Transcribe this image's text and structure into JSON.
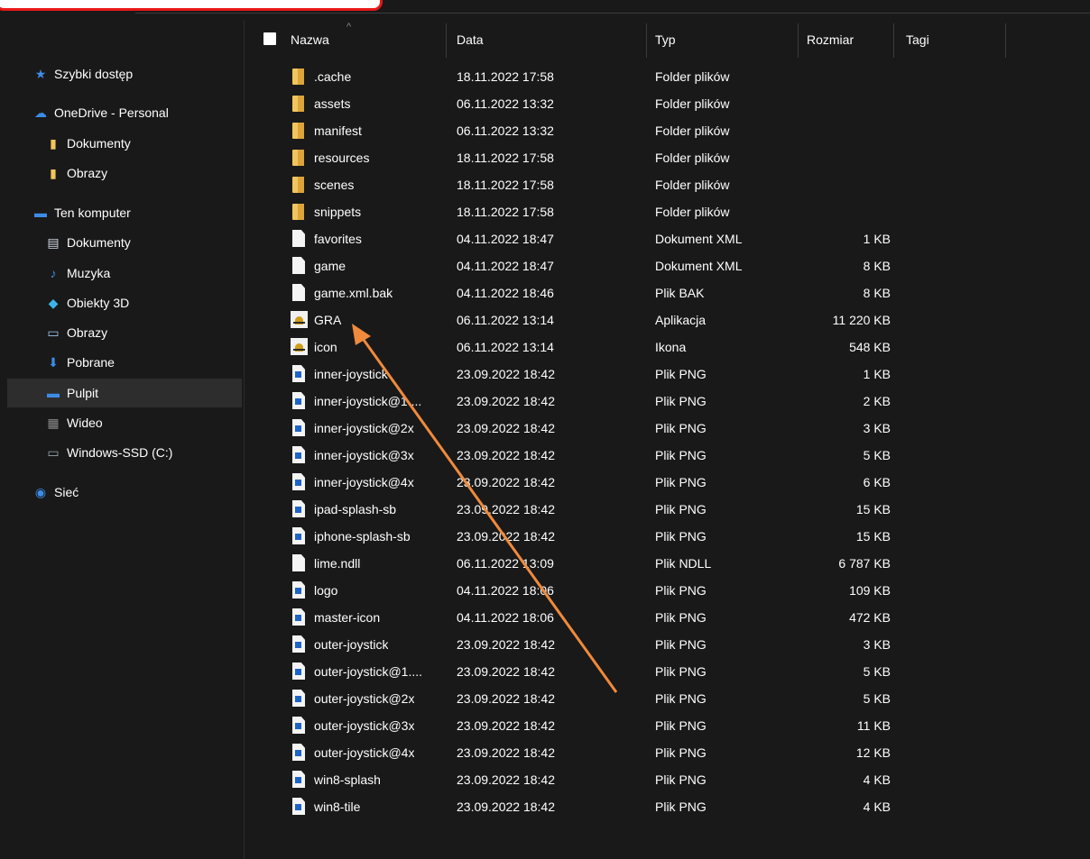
{
  "sidebar": {
    "items": [
      {
        "label": "Szybki dostęp",
        "icon": "star-icon",
        "color": "#3c8ce7"
      },
      {
        "label": "OneDrive - Personal",
        "icon": "cloud-icon",
        "color": "#3c8ce7"
      },
      {
        "label": "Dokumenty",
        "icon": "folder-icon",
        "color": "#f2c55c"
      },
      {
        "label": "Obrazy",
        "icon": "folder-icon",
        "color": "#f2c55c"
      },
      {
        "label": "Ten komputer",
        "icon": "computer-icon",
        "color": "#3c8ce7"
      },
      {
        "label": "Dokumenty",
        "icon": "documents-icon",
        "color": "#cfd8e3"
      },
      {
        "label": "Muzyka",
        "icon": "music-icon",
        "color": "#3c8ce7"
      },
      {
        "label": "Obiekty 3D",
        "icon": "cube-icon",
        "color": "#3cb6e7"
      },
      {
        "label": "Obrazy",
        "icon": "pictures-icon",
        "color": "#9cc8f0"
      },
      {
        "label": "Pobrane",
        "icon": "download-icon",
        "color": "#3c8ce7"
      },
      {
        "label": "Pulpit",
        "icon": "desktop-icon",
        "color": "#3c8ce7",
        "selected": true
      },
      {
        "label": "Wideo",
        "icon": "film-icon",
        "color": "#8a8a8a"
      },
      {
        "label": "Windows-SSD (C:)",
        "icon": "drive-icon",
        "color": "#9aa4ad"
      },
      {
        "label": "Sieć",
        "icon": "network-icon",
        "color": "#3c8ce7"
      }
    ]
  },
  "columns": {
    "name": "Nazwa",
    "date": "Data",
    "type": "Typ",
    "size": "Rozmiar",
    "tags": "Tagi"
  },
  "files": [
    {
      "name": ".cache",
      "date": "18.11.2022 17:58",
      "type": "Folder plików",
      "size": "",
      "icon": "folder-icon"
    },
    {
      "name": "assets",
      "date": "06.11.2022 13:32",
      "type": "Folder plików",
      "size": "",
      "icon": "folder-icon"
    },
    {
      "name": "manifest",
      "date": "06.11.2022 13:32",
      "type": "Folder plików",
      "size": "",
      "icon": "folder-icon"
    },
    {
      "name": "resources",
      "date": "18.11.2022 17:58",
      "type": "Folder plików",
      "size": "",
      "icon": "folder-icon"
    },
    {
      "name": "scenes",
      "date": "18.11.2022 17:58",
      "type": "Folder plików",
      "size": "",
      "icon": "folder-icon"
    },
    {
      "name": "snippets",
      "date": "18.11.2022 17:58",
      "type": "Folder plików",
      "size": "",
      "icon": "folder-icon"
    },
    {
      "name": "favorites",
      "date": "04.11.2022 18:47",
      "type": "Dokument XML",
      "size": "1 KB",
      "icon": "document-icon"
    },
    {
      "name": "game",
      "date": "04.11.2022 18:47",
      "type": "Dokument XML",
      "size": "8 KB",
      "icon": "document-icon"
    },
    {
      "name": "game.xml.bak",
      "date": "04.11.2022 18:46",
      "type": "Plik BAK",
      "size": "8 KB",
      "icon": "document-icon"
    },
    {
      "name": "GRA",
      "date": "06.11.2022 13:14",
      "type": "Aplikacja",
      "size": "11 220 KB",
      "icon": "application-icon"
    },
    {
      "name": "icon",
      "date": "06.11.2022 13:14",
      "type": "Ikona",
      "size": "548 KB",
      "icon": "application-icon"
    },
    {
      "name": "inner-joystick",
      "date": "23.09.2022 18:42",
      "type": "Plik PNG",
      "size": "1 KB",
      "icon": "image-file-icon"
    },
    {
      "name": "inner-joystick@1....",
      "date": "23.09.2022 18:42",
      "type": "Plik PNG",
      "size": "2 KB",
      "icon": "image-file-icon"
    },
    {
      "name": "inner-joystick@2x",
      "date": "23.09.2022 18:42",
      "type": "Plik PNG",
      "size": "3 KB",
      "icon": "image-file-icon"
    },
    {
      "name": "inner-joystick@3x",
      "date": "23.09.2022 18:42",
      "type": "Plik PNG",
      "size": "5 KB",
      "icon": "image-file-icon"
    },
    {
      "name": "inner-joystick@4x",
      "date": "23.09.2022 18:42",
      "type": "Plik PNG",
      "size": "6 KB",
      "icon": "image-file-icon"
    },
    {
      "name": "ipad-splash-sb",
      "date": "23.09.2022 18:42",
      "type": "Plik PNG",
      "size": "15 KB",
      "icon": "image-file-icon"
    },
    {
      "name": "iphone-splash-sb",
      "date": "23.09.2022 18:42",
      "type": "Plik PNG",
      "size": "15 KB",
      "icon": "image-file-icon"
    },
    {
      "name": "lime.ndll",
      "date": "06.11.2022 13:09",
      "type": "Plik NDLL",
      "size": "6 787 KB",
      "icon": "document-icon"
    },
    {
      "name": "logo",
      "date": "04.11.2022 18:06",
      "type": "Plik PNG",
      "size": "109 KB",
      "icon": "image-file-icon"
    },
    {
      "name": "master-icon",
      "date": "04.11.2022 18:06",
      "type": "Plik PNG",
      "size": "472 KB",
      "icon": "image-file-icon"
    },
    {
      "name": "outer-joystick",
      "date": "23.09.2022 18:42",
      "type": "Plik PNG",
      "size": "3 KB",
      "icon": "image-file-icon"
    },
    {
      "name": "outer-joystick@1....",
      "date": "23.09.2022 18:42",
      "type": "Plik PNG",
      "size": "5 KB",
      "icon": "image-file-icon"
    },
    {
      "name": "outer-joystick@2x",
      "date": "23.09.2022 18:42",
      "type": "Plik PNG",
      "size": "5 KB",
      "icon": "image-file-icon"
    },
    {
      "name": "outer-joystick@3x",
      "date": "23.09.2022 18:42",
      "type": "Plik PNG",
      "size": "11 KB",
      "icon": "image-file-icon"
    },
    {
      "name": "outer-joystick@4x",
      "date": "23.09.2022 18:42",
      "type": "Plik PNG",
      "size": "12 KB",
      "icon": "image-file-icon"
    },
    {
      "name": "win8-splash",
      "date": "23.09.2022 18:42",
      "type": "Plik PNG",
      "size": "4 KB",
      "icon": "image-file-icon"
    },
    {
      "name": "win8-tile",
      "date": "23.09.2022 18:42",
      "type": "Plik PNG",
      "size": "4 KB",
      "icon": "image-file-icon"
    }
  ],
  "annotation": {
    "color": "#f08a3c",
    "highlight_color": "#e81818",
    "points_to": "GRA"
  }
}
